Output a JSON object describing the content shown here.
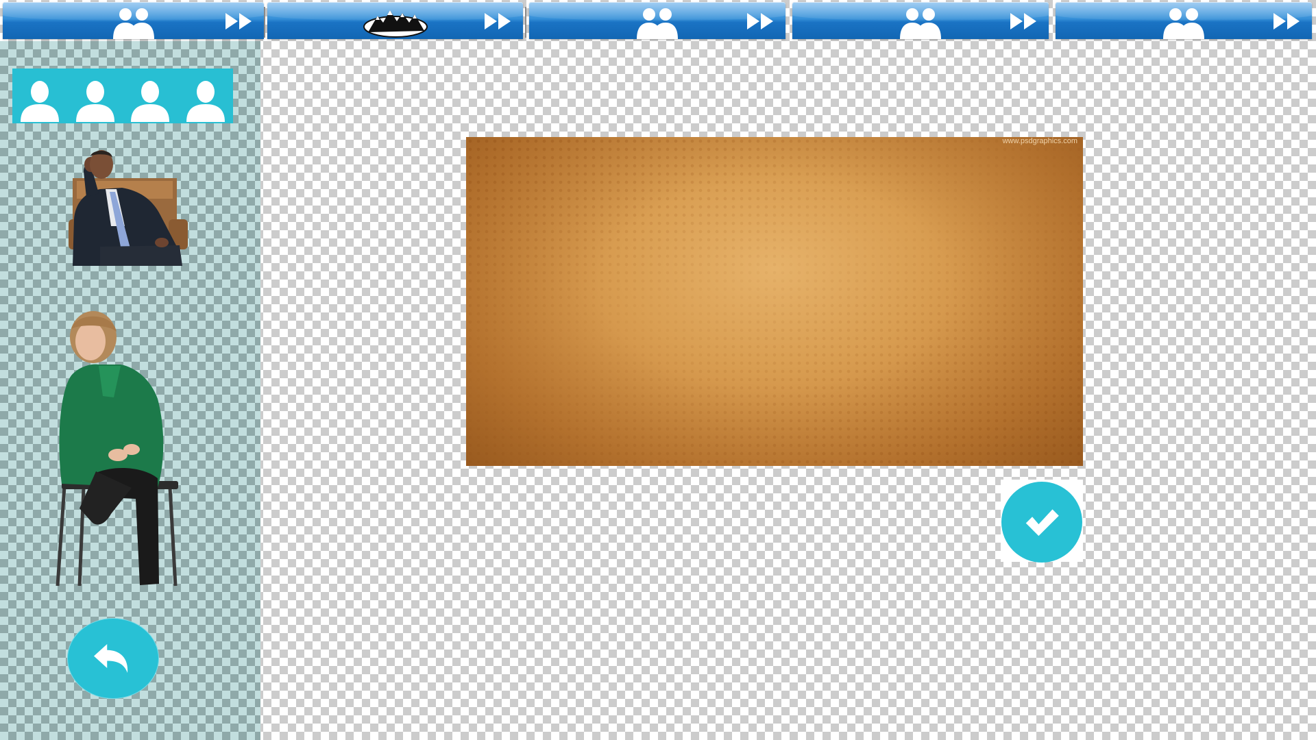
{
  "top_tabs": [
    {
      "name": "tab-characters-1",
      "icon": "two-people-silhouette-icon"
    },
    {
      "name": "tab-backgrounds",
      "icon": "mountains-icon"
    },
    {
      "name": "tab-characters-3",
      "icon": "two-people-silhouette-icon"
    },
    {
      "name": "tab-characters-4",
      "icon": "two-people-silhouette-icon"
    },
    {
      "name": "tab-characters-5",
      "icon": "two-people-silhouette-icon"
    }
  ],
  "tab_next_icon": "fast-forward-icon",
  "sidebar": {
    "people_bar": [
      "person-silhouette-icon",
      "person-silhouette-icon",
      "person-silhouette-icon",
      "person-silhouette-icon"
    ],
    "characters": [
      "seated-man-in-suit",
      "seated-woman-in-green-jacket"
    ],
    "back_icon": "undo-arrow-icon"
  },
  "canvas": {
    "background": "orange-halftone-backdrop",
    "watermark": "www.psdgraphics.com"
  },
  "confirm_icon": "checkmark-icon",
  "colors": {
    "tab_blue": "#1a73c4",
    "accent_cyan": "#28c1d5",
    "sidebar_teal": "#c2dede"
  }
}
